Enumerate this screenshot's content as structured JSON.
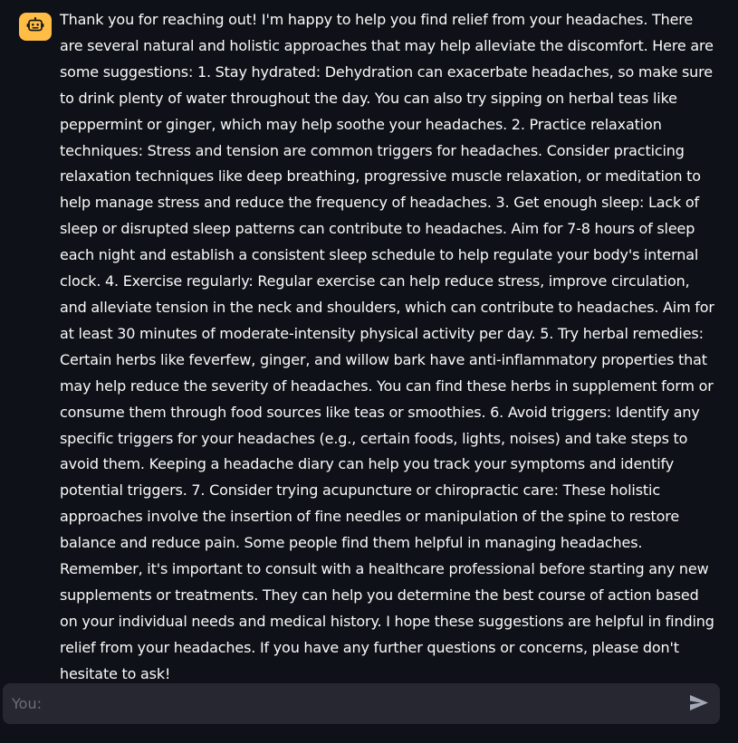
{
  "message": {
    "avatar_icon": "robot-icon",
    "avatar_color": "#ffbd45",
    "text": "Thank you for reaching out! I'm happy to help you find relief from your headaches. There are several natural and holistic approaches that may help alleviate the discomfort. Here are some suggestions: 1. Stay hydrated: Dehydration can exacerbate headaches, so make sure to drink plenty of water throughout the day. You can also try sipping on herbal teas like peppermint or ginger, which may help soothe your headaches. 2. Practice relaxation techniques: Stress and tension are common triggers for headaches. Consider practicing relaxation techniques like deep breathing, progressive muscle relaxation, or meditation to help manage stress and reduce the frequency of headaches. 3. Get enough sleep: Lack of sleep or disrupted sleep patterns can contribute to headaches. Aim for 7-8 hours of sleep each night and establish a consistent sleep schedule to help regulate your body's internal clock. 4. Exercise regularly: Regular exercise can help reduce stress, improve circulation, and alleviate tension in the neck and shoulders, which can contribute to headaches. Aim for at least 30 minutes of moderate-intensity physical activity per day. 5. Try herbal remedies: Certain herbs like feverfew, ginger, and willow bark have anti-inflammatory properties that may help reduce the severity of headaches. You can find these herbs in supplement form or consume them through food sources like teas or smoothies. 6. Avoid triggers: Identify any specific triggers for your headaches (e.g., certain foods, lights, noises) and take steps to avoid them. Keeping a headache diary can help you track your symptoms and identify potential triggers. 7. Consider trying acupuncture or chiropractic care: These holistic approaches involve the insertion of fine needles or manipulation of the spine to restore balance and reduce pain. Some people find them helpful in managing headaches. Remember, it's important to consult with a healthcare professional before starting any new supplements or treatments. They can help you determine the best course of action based on your individual needs and medical history. I hope these suggestions are helpful in finding relief from your headaches. If you have any further questions or concerns, please don't hesitate to ask!"
  },
  "input": {
    "placeholder": "You:",
    "value": "",
    "send_icon": "send-icon"
  },
  "colors": {
    "background": "#0e1117",
    "input_background": "#262730",
    "text": "#fafafa",
    "placeholder": "#6c6e77",
    "send_icon": "#a3a8b8"
  }
}
